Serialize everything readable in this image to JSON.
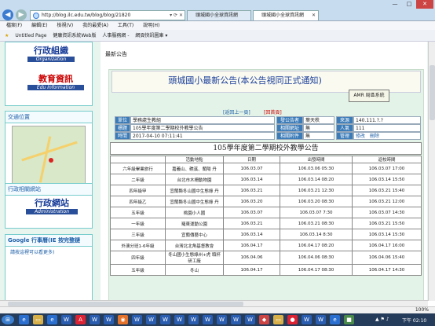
{
  "browser": {
    "address": "http://blog.ilc.edu.tw/blog/blog/21820",
    "tab1": "頭城國小全球資訊網",
    "tab2": "頭城國小全球資訊網",
    "addr_controls": "▾ ⟳ ✕"
  },
  "menu": [
    "檔案(F)",
    "編輯(E)",
    "檢視(V)",
    "我的最愛(A)",
    "工具(T)",
    "說明(H)"
  ],
  "favorites": [
    "Untitled Page",
    "健康資訊系統Web版",
    "人事服務網 -",
    "網頁快訊圖庫 ▾"
  ],
  "sidebar": {
    "logo1": "行政組織",
    "logo1_sub": "Organization",
    "logo2": "教育資訊",
    "logo2_sub": "Edu Information",
    "traffic_title": "交通位置",
    "admin_title": "行政相關網站",
    "admin_logo": "行政網站",
    "admin_sub": "Administration",
    "google_title": "Google 行事曆(IE 按完整鏈",
    "google_note": "請按這裡可以看更多)"
  },
  "main": {
    "section": "最新公告",
    "title": "頭城國小最新公告(本公告視同正式通知)",
    "badge": "AMR 局區系統",
    "back_link": "[返回上一頁]",
    "home_link": "[回首頁]"
  },
  "meta": {
    "l_unit": "單位",
    "v_unit": "學務處生教組",
    "l_poster": "發公告者",
    "v_poster": "葉天秩",
    "l_source": "來源",
    "v_source": "140.111.?.?",
    "l_title": "標題",
    "v_title": "105學年度第二學期校外教學公告",
    "l_url": "相關網址",
    "v_url": "無",
    "l_count": "人氣",
    "v_count": "111",
    "l_time": "時間",
    "v_time": "2017-04-10 07:11:41",
    "l_file": "相關附件",
    "v_file": "無",
    "l_manage": "管理",
    "v_edit": "修改",
    "v_delete": "刪除"
  },
  "table": {
    "title": "105學年度第二學期校外教學公告",
    "headers": [
      "",
      "活動地點",
      "日期",
      "出發時間",
      "返校時間"
    ],
    "rows": [
      [
        "六年級畢業旅行",
        "嘉義山、礁溪、蘭陽 丹",
        "106.03.07",
        "106.03.06 05:30",
        "106.03.07 17:00"
      ],
      [
        "二年級",
        "台北市木柵動物園",
        "106.03.14",
        "106.03.14 08:20",
        "106.03.14 15:50"
      ],
      [
        "四年級甲",
        "宜蘭縣冬山國中生態綠 丹",
        "106.03.21",
        "106.03.21 12:30",
        "106.03.21 15:40"
      ],
      [
        "四年級乙",
        "宜蘭縣冬山國中生態綠 丹",
        "106.03.20",
        "106.03.20 08:30",
        "106.03.21 12:00"
      ],
      [
        "五年級",
        "桃園小人國",
        "106.03.07",
        "106.03.07 7:30",
        "106.03.07 14:30"
      ],
      [
        "一年級",
        "羅東運動公園",
        "106.03.21",
        "106.03.21 08:30",
        "106.03.21 15:50"
      ],
      [
        "三年級",
        "宜蘭傳藝中心",
        "106.03.14",
        "106.03.14 8:30",
        "106.03.14 15:30"
      ],
      [
        "外澳分班1-6年級",
        "台灣北北角基督教會",
        "106.04.17",
        "106.04.17 08:20",
        "106.04.17 16:00"
      ],
      [
        "四年級",
        "冬山國小生態綠州+虎 頭杯研工廠",
        "106.04.06",
        "106.04.06 08:30",
        "106.04.06 15:40"
      ],
      [
        "五年級",
        "冬山",
        "106.04.17",
        "106.04.17 08:30",
        "106.04.17 14:30"
      ]
    ]
  },
  "status": {
    "zoom": "100%"
  },
  "taskbar": {
    "clock": "下午 02:10"
  }
}
